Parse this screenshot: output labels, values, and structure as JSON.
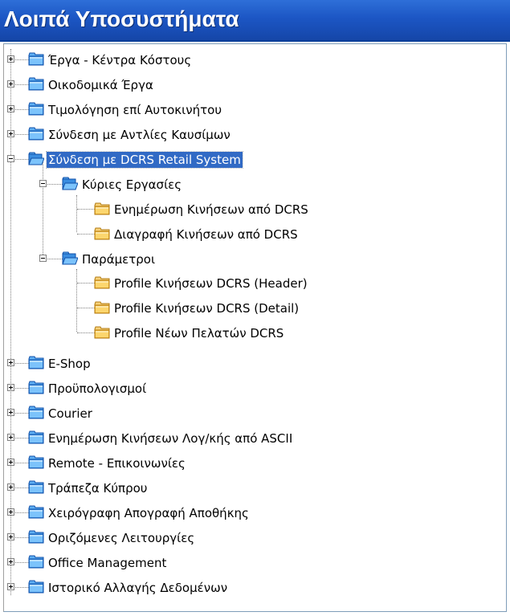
{
  "window": {
    "title": "Λοιπά Υποσυστήματα"
  },
  "colors": {
    "title_bg": "#1c56c4",
    "selection": "#316ac5",
    "folder_blue": "#3a8de0",
    "folder_yellow": "#f8c850"
  },
  "tree": {
    "top": [
      {
        "label": "Έργα - Κέντρα Κόστους",
        "state": "collapsed",
        "icon": "folder-closed-icon"
      },
      {
        "label": "Οικοδομικά Έργα",
        "state": "collapsed",
        "icon": "folder-closed-icon"
      },
      {
        "label": "Τιμολόγηση επί Αυτοκινήτου",
        "state": "collapsed",
        "icon": "folder-closed-icon"
      },
      {
        "label": "Σύνδεση με Αντλίες Καυσίμων",
        "state": "collapsed",
        "icon": "folder-closed-icon"
      },
      {
        "label": "Σύνδεση με DCRS Retail System",
        "state": "expanded",
        "selected": true,
        "icon": "folder-open-icon"
      }
    ],
    "dcrs_children": [
      {
        "label": "Κύριες Εργασίες",
        "state": "expanded",
        "icon": "folder-open-icon",
        "children": [
          {
            "label": "Ενημέρωση Κινήσεων από DCRS",
            "icon": "yellow-folder-icon"
          },
          {
            "label": "Διαγραφή Κινήσεων από DCRS",
            "icon": "yellow-folder-icon"
          }
        ]
      },
      {
        "label": "Παράμετροι",
        "state": "expanded",
        "icon": "folder-open-icon",
        "children": [
          {
            "label": "Profile Κινήσεων DCRS (Header)",
            "icon": "yellow-folder-icon"
          },
          {
            "label": "Profile Κινήσεων DCRS (Detail)",
            "icon": "yellow-folder-icon"
          },
          {
            "label": "Profile Νέων Πελατών DCRS",
            "icon": "yellow-folder-icon"
          }
        ]
      }
    ],
    "bottom": [
      {
        "label": "E-Shop",
        "state": "collapsed",
        "icon": "folder-closed-icon"
      },
      {
        "label": "Προϋπολογισμοί",
        "state": "collapsed",
        "icon": "folder-closed-icon"
      },
      {
        "label": "Courier",
        "state": "collapsed",
        "icon": "folder-closed-icon"
      },
      {
        "label": "Ενημέρωση Κινήσεων Λογ/κής από ASCII",
        "state": "collapsed",
        "icon": "folder-closed-icon"
      },
      {
        "label": "Remote - Επικοινωνίες",
        "state": "collapsed",
        "icon": "folder-closed-icon"
      },
      {
        "label": "Τράπεζα Κύπρου",
        "state": "collapsed",
        "icon": "folder-closed-icon"
      },
      {
        "label": "Χειρόγραφη Απογραφή Αποθήκης",
        "state": "collapsed",
        "icon": "folder-closed-icon"
      },
      {
        "label": "Οριζόμενες Λειτουργίες",
        "state": "collapsed",
        "icon": "folder-closed-icon"
      },
      {
        "label": "Office Management",
        "state": "collapsed",
        "icon": "folder-closed-icon"
      },
      {
        "label": "Ιστορικό Αλλαγής Δεδομένων",
        "state": "collapsed",
        "icon": "folder-closed-icon"
      }
    ]
  }
}
